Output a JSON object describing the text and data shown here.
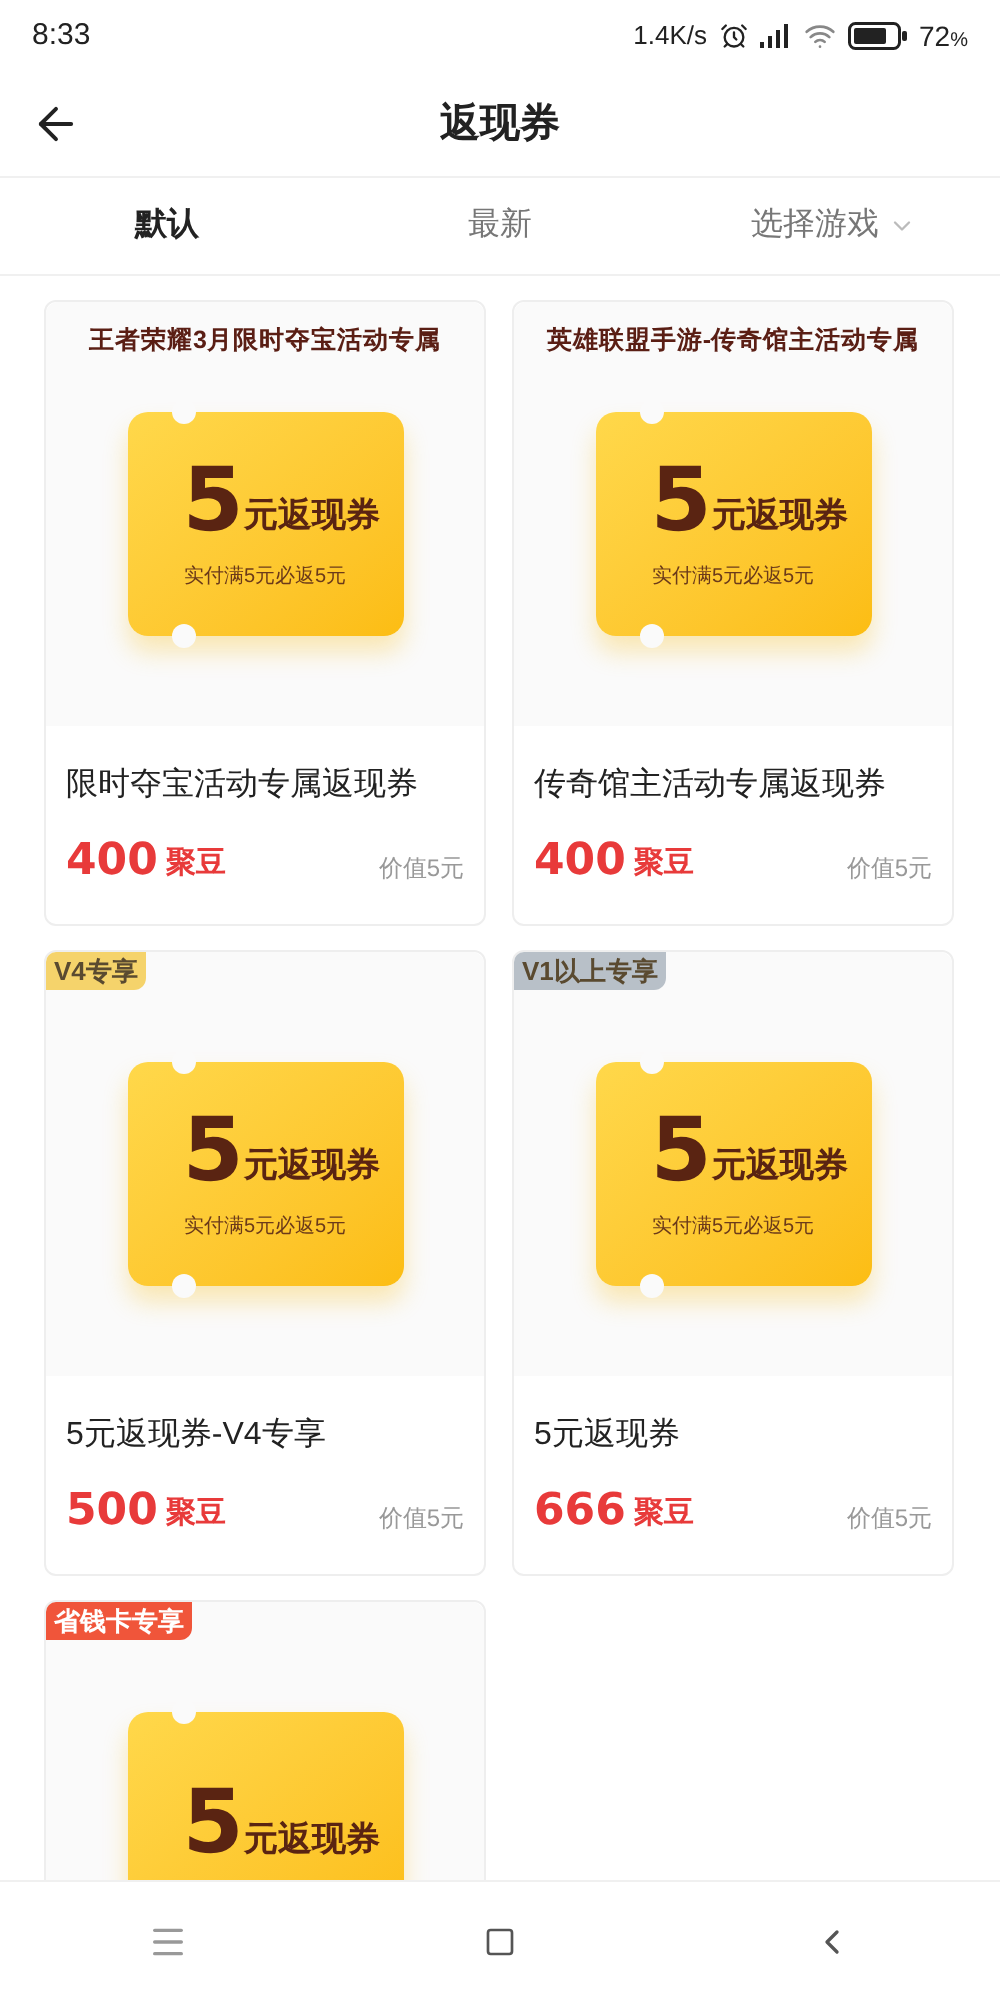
{
  "status_bar": {
    "time": "8:33",
    "speed": "1.4K/s",
    "battery": "72",
    "battery_unit": "%"
  },
  "header": {
    "title": "返现券"
  },
  "tabs": [
    {
      "label": "默认",
      "selected": true,
      "dropdown": false
    },
    {
      "label": "最新",
      "selected": false,
      "dropdown": false
    },
    {
      "label": "选择游戏",
      "selected": false,
      "dropdown": true
    }
  ],
  "cards": [
    {
      "banner": "王者荣耀3月限时夺宝活动专属",
      "ticket": {
        "amount": "5",
        "unit": "元返现券",
        "condition": "实付满5元必返5元"
      },
      "title": "限时夺宝活动专属返现券",
      "price": "400",
      "currency": "聚豆",
      "worth": "价值5元"
    },
    {
      "banner": "英雄联盟手游-传奇馆主活动专属",
      "ticket": {
        "amount": "5",
        "unit": "元返现券",
        "condition": "实付满5元必返5元"
      },
      "title": "传奇馆主活动专属返现券",
      "price": "400",
      "currency": "聚豆",
      "worth": "价值5元"
    },
    {
      "badge": {
        "label": "V4专享",
        "color": "#f5d36b"
      },
      "ticket": {
        "amount": "5",
        "unit": "元返现券",
        "condition": "实付满5元必返5元"
      },
      "title": "5元返现券-V4专享",
      "price": "500",
      "currency": "聚豆",
      "worth": "价值5元"
    },
    {
      "badge": {
        "label": "V1以上专享",
        "color": "#b8c0c8"
      },
      "ticket": {
        "amount": "5",
        "unit": "元返现券",
        "condition": "实付满5元必返5元"
      },
      "title": "5元返现券",
      "price": "666",
      "currency": "聚豆",
      "worth": "价值5元"
    },
    {
      "badge": {
        "label": "省钱卡专享",
        "color": "#f0553a"
      },
      "ticket": {
        "amount": "5",
        "unit": "元返现券"
      }
    }
  ]
}
